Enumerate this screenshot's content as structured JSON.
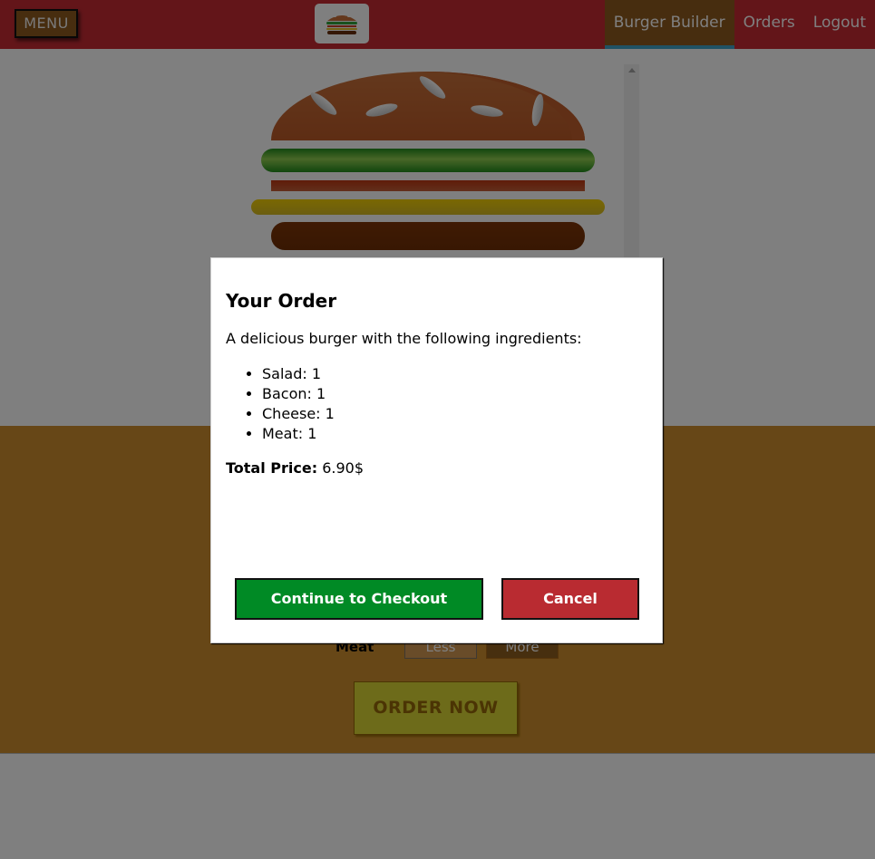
{
  "toolbar": {
    "menu_label": "MENU",
    "logo_icon": "burger-logo-icon",
    "nav": [
      {
        "label": "Burger Builder",
        "active": true
      },
      {
        "label": "Orders",
        "active": false
      },
      {
        "label": "Logout",
        "active": false
      }
    ]
  },
  "burger": {
    "ingredients": [
      "bread-top",
      "salad",
      "bacon",
      "cheese",
      "meat"
    ]
  },
  "controls": {
    "visible_row": {
      "label": "Meat",
      "less_label": "Less",
      "more_label": "More"
    },
    "order_button": "ORDER NOW"
  },
  "modal": {
    "title": "Your Order",
    "description": "A delicious burger with the following ingredients:",
    "ingredients": [
      {
        "text": "Salad: 1"
      },
      {
        "text": "Bacon: 1"
      },
      {
        "text": "Cheese: 1"
      },
      {
        "text": "Meat: 1"
      }
    ],
    "price_label": "Total Price:",
    "price_value": "6.90$",
    "continue_label": "Continue to Checkout",
    "cancel_label": "Cancel"
  },
  "colors": {
    "toolbar": "#c62b33",
    "nav_active": "#8f5a1f",
    "controls_bg": "#cf8f2e",
    "continue": "#008a25",
    "cancel": "#b92b31",
    "order_now": "#dad735"
  }
}
